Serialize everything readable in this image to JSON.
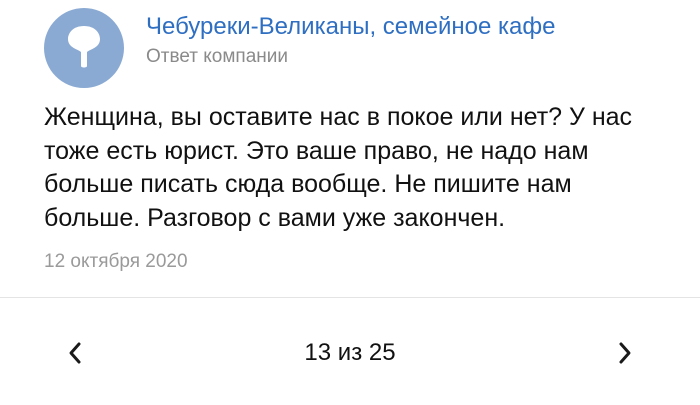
{
  "review_reply": {
    "company_name": "Чебуреки-Великаны, семейное кафе",
    "reply_label": "Ответ компании",
    "avatar_icon": "map-pin-icon",
    "message": "Женщина, вы оставите нас в покое или нет? У нас тоже есть юрист. Это ваше право, не надо нам больше писать сюда вообще. Не пишите нам больше. Разговор с вами уже закончен.",
    "date": "12 октября 2020"
  },
  "pager": {
    "counter": "13 из 25",
    "prev_icon": "chevron-left-icon",
    "next_icon": "chevron-right-icon"
  },
  "colors": {
    "link": "#2f6fc2",
    "avatar_bg": "#8aaad3",
    "muted_text": "#8a8a8a"
  }
}
